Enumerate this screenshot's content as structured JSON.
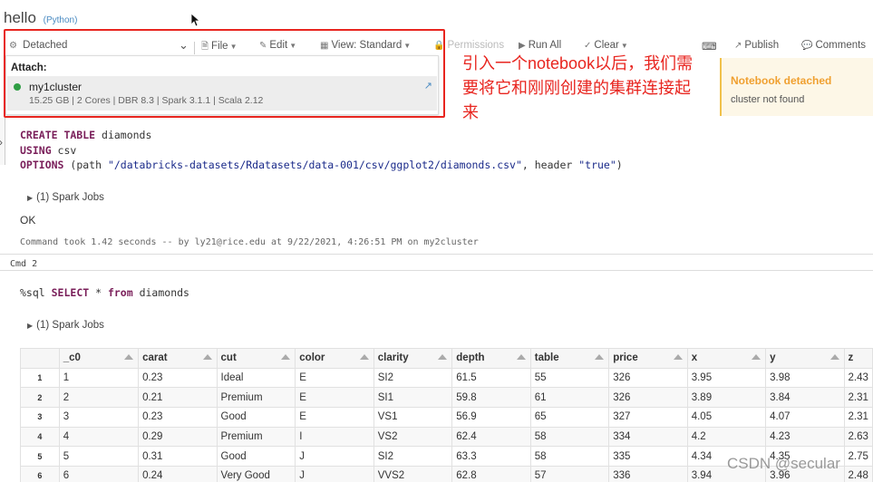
{
  "notebook": {
    "title": "hello",
    "language": "(Python)"
  },
  "toolbar": {
    "cluster_status": "Detached",
    "file": "File",
    "edit": "Edit",
    "view": "View: Standard",
    "permissions": "Permissions",
    "run_all": "Run All",
    "clear": "Clear",
    "publish": "Publish",
    "comments": "Comments"
  },
  "attach": {
    "label": "Attach:",
    "cluster_name": "my1cluster",
    "cluster_detail": "15.25 GB | 2 Cores | DBR 8.3 | Spark 3.1.1 | Scala 2.12",
    "status_color": "#2f9e44"
  },
  "annotation": "引入一个notebook以后，我们需要将它和刚刚创建的集群连接起来",
  "notice": {
    "title": "Notebook detached",
    "text": "cluster not found"
  },
  "cell1": {
    "kw_create": "CREATE TABLE",
    "create_rest": " diamonds",
    "kw_using": "USING",
    "using_rest": " csv",
    "kw_options": "OPTIONS",
    "options_a": " (path ",
    "path_str": "\"/databricks-datasets/Rdatasets/data-001/csv/ggplot2/diamonds.csv\"",
    "options_b": ", header ",
    "header_str": "\"true\"",
    "options_c": ")",
    "spark_jobs": "(1) Spark Jobs",
    "result": "OK",
    "command_time": "Command took 1.42 seconds -- by ly21@rice.edu at 9/22/2021, 4:26:51 PM on my2cluster"
  },
  "cell2": {
    "label": "Cmd 2",
    "magic": "%sql ",
    "kw_select": "SELECT",
    "star": " * ",
    "kw_from": "from",
    "from_rest": " diamonds",
    "spark_jobs": "(1) Spark Jobs"
  },
  "table": {
    "columns": [
      "_c0",
      "carat",
      "cut",
      "color",
      "clarity",
      "depth",
      "table",
      "price",
      "x",
      "y",
      "z"
    ],
    "rows": [
      [
        "1",
        "1",
        "0.23",
        "Ideal",
        "E",
        "SI2",
        "61.5",
        "55",
        "326",
        "3.95",
        "3.98",
        "2.43"
      ],
      [
        "2",
        "2",
        "0.21",
        "Premium",
        "E",
        "SI1",
        "59.8",
        "61",
        "326",
        "3.89",
        "3.84",
        "2.31"
      ],
      [
        "3",
        "3",
        "0.23",
        "Good",
        "E",
        "VS1",
        "56.9",
        "65",
        "327",
        "4.05",
        "4.07",
        "2.31"
      ],
      [
        "4",
        "4",
        "0.29",
        "Premium",
        "I",
        "VS2",
        "62.4",
        "58",
        "334",
        "4.2",
        "4.23",
        "2.63"
      ],
      [
        "5",
        "5",
        "0.31",
        "Good",
        "J",
        "SI2",
        "63.3",
        "58",
        "335",
        "4.34",
        "4.35",
        "2.75"
      ],
      [
        "6",
        "6",
        "0.24",
        "Very Good",
        "J",
        "VVS2",
        "62.8",
        "57",
        "336",
        "3.94",
        "3.96",
        "2.48"
      ]
    ]
  },
  "watermark": "CSDN @secular"
}
